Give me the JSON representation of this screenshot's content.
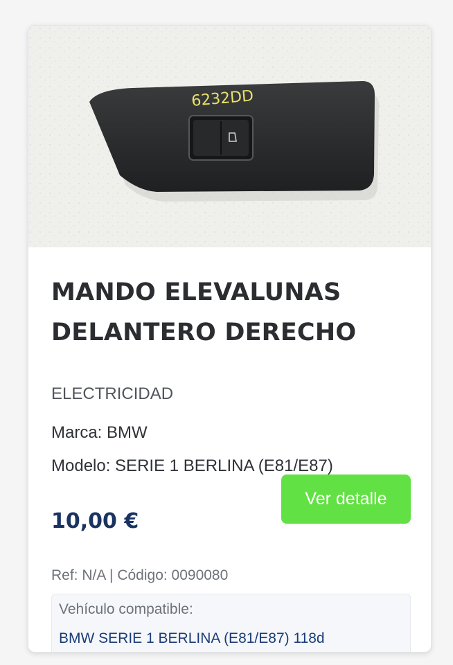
{
  "product": {
    "title_line1": "MANDO ELEVALUNAS",
    "title_line2": "DELANTERO DERECHO",
    "category": "ELECTRICIDAD",
    "brand": "Marca: BMW",
    "model": "Modelo: SERIE 1 BERLINA (E81/E87)",
    "price": "10,00 €",
    "detail_button_label": "Ver detalle",
    "ref_line": "Ref: N/A | Código: 0090080",
    "compatible_label": "Vehículo compatible:",
    "compatible_vehicle": "BMW SERIE 1 BERLINA (E81/E87) 118d",
    "photo_marking": "6232DD"
  },
  "colors": {
    "button_bg": "#62e144",
    "price": "#1a3362",
    "link": "#1c3c78"
  }
}
